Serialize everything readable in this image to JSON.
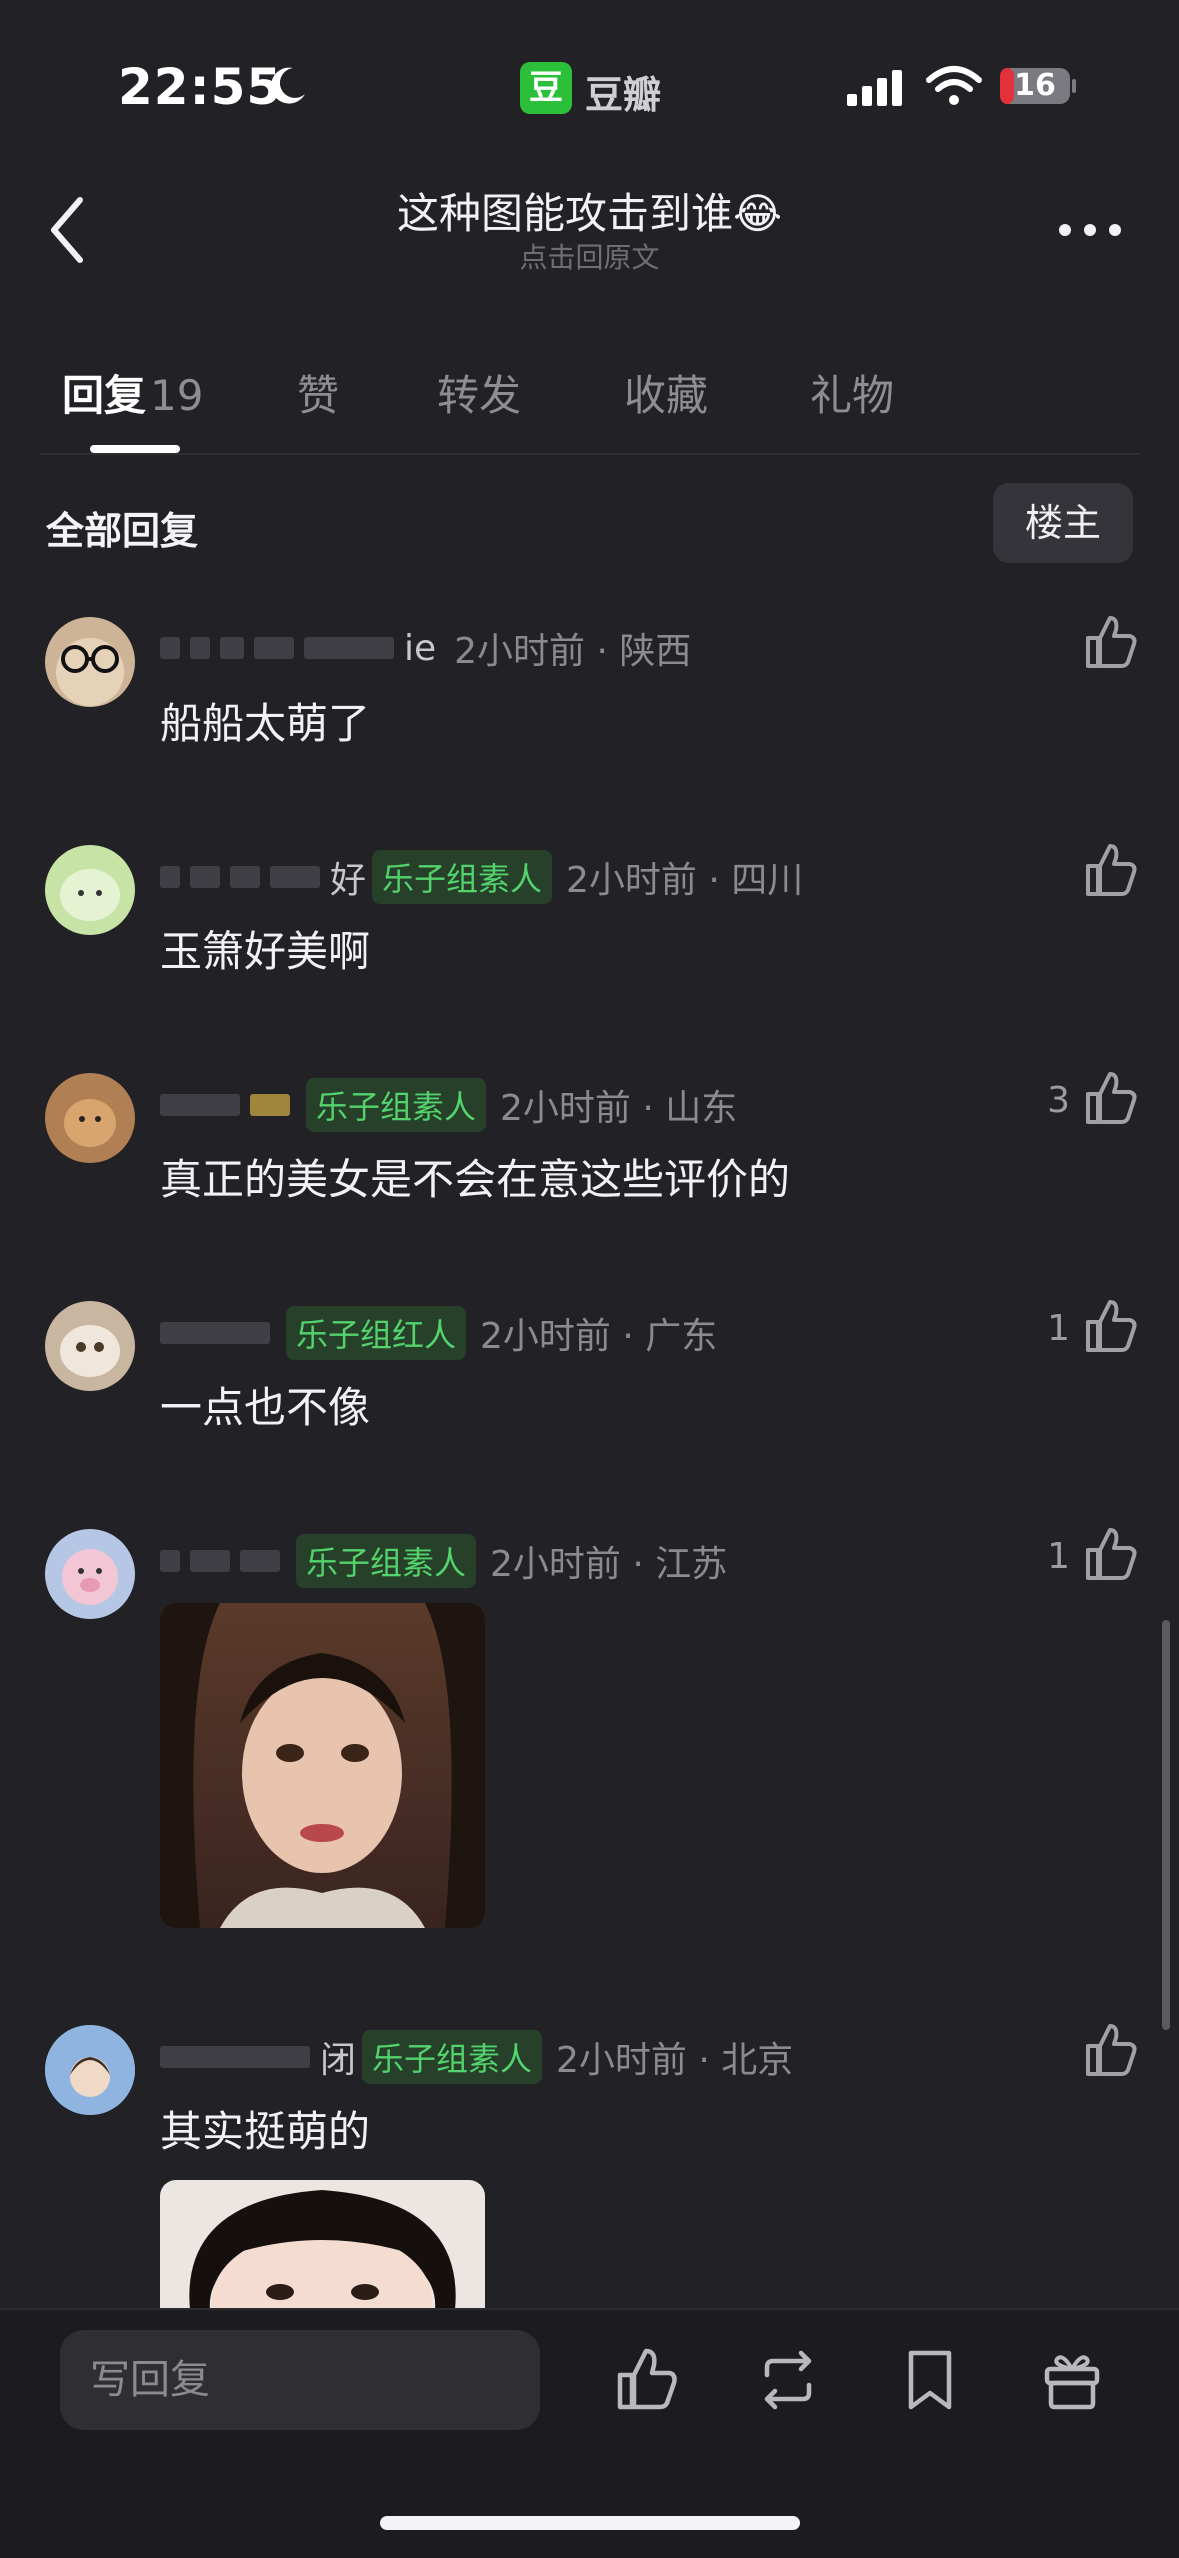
{
  "status_bar": {
    "time": "22:55",
    "app_icon_text": "豆",
    "app_name": "豆瓣",
    "battery": "16"
  },
  "header": {
    "title": "这种图能攻击到谁😂",
    "subtitle": "点击回原文"
  },
  "tabs": [
    {
      "label": "回复",
      "count": "19"
    },
    {
      "label": "赞"
    },
    {
      "label": "转发"
    },
    {
      "label": "收藏"
    },
    {
      "label": "礼物"
    }
  ],
  "section": {
    "title": "全部回复",
    "owner_button": "楼主"
  },
  "comments": [
    {
      "name": "ie",
      "time_loc": "2小时前 · 陕西",
      "text": "船船太萌了",
      "likes": ""
    },
    {
      "name": "好",
      "badge": "乐子组素人",
      "time_loc": "2小时前 · 四川",
      "text": "玉箫好美啊",
      "likes": ""
    },
    {
      "badge": "乐子组素人",
      "time_loc": "2小时前 · 山东",
      "text": "真正的美女是不会在意这些评价的",
      "likes": "3"
    },
    {
      "badge": "乐子组红人",
      "time_loc": "2小时前 · 广东",
      "text": "一点也不像",
      "likes": "1"
    },
    {
      "badge": "乐子组素人",
      "time_loc": "2小时前 · 江苏",
      "text": "",
      "likes": "1"
    },
    {
      "name": "闭",
      "badge": "乐子组素人",
      "time_loc": "2小时前 · 北京",
      "text": "其实挺萌的",
      "likes": ""
    }
  ],
  "bottom_bar": {
    "reply_placeholder": "写回复"
  },
  "colors": {
    "background": "#212126",
    "badge_text": "#53d36c",
    "badge_bg": "#26402a",
    "app_green": "#2bbf3a"
  },
  "icons": [
    "moon-icon",
    "signal-icon",
    "wifi-icon",
    "battery-icon",
    "back-icon",
    "more-icon",
    "thumbs-up-icon",
    "repost-icon",
    "bookmark-icon",
    "gift-icon"
  ]
}
